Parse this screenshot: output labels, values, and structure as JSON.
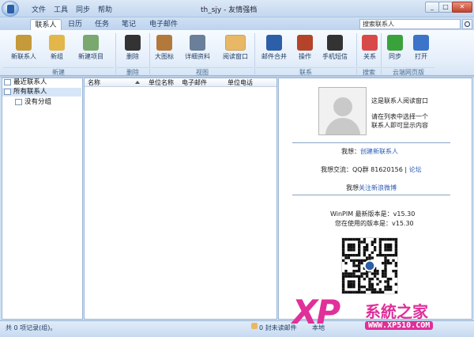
{
  "titlebar": {
    "menus": [
      "文件",
      "工具",
      "同步",
      "帮助"
    ],
    "window_title": "th_sjy - 友情强档"
  },
  "ribbon_tabs": [
    "联系人",
    "日历",
    "任务",
    "笔记",
    "电子邮件"
  ],
  "search": {
    "placeholder": "搜索联系人"
  },
  "ribbon": {
    "buttons": [
      {
        "label": "新联系人",
        "icon": "new-contact-icon",
        "color": "#c49a3a"
      },
      {
        "label": "新组",
        "icon": "new-group-icon",
        "color": "#e3b64a"
      },
      {
        "label": "新建项目",
        "icon": "new-item-icon",
        "color": "#7aa86f"
      },
      {
        "label": "删除",
        "icon": "delete-icon",
        "color": "#333333"
      },
      {
        "label": "大图标",
        "icon": "large-icons-icon",
        "color": "#b3793a"
      },
      {
        "label": "详细资料",
        "icon": "details-icon",
        "color": "#6a7f99"
      },
      {
        "label": "阅读窗口",
        "icon": "reading-pane-icon",
        "color": "#e8b867"
      },
      {
        "label": "邮件合并",
        "icon": "mail-merge-icon",
        "color": "#2d5ea8"
      },
      {
        "label": "操作",
        "icon": "action-icon",
        "color": "#b5432a"
      },
      {
        "label": "手机短信",
        "icon": "sms-phone-icon",
        "color": "#333333"
      },
      {
        "label": "关系",
        "icon": "relation-icon",
        "color": "#d84a4a"
      },
      {
        "label": "同步",
        "icon": "sync-icon",
        "color": "#3aa23a"
      },
      {
        "label": "打开",
        "icon": "open-icon",
        "color": "#3b74c9"
      }
    ],
    "groups": [
      "新建",
      "删除",
      "视图",
      "联系",
      "搜索",
      "云端网页版"
    ]
  },
  "nav": {
    "items": [
      "最近联系人",
      "所有联系人",
      "没有分组"
    ]
  },
  "list": {
    "columns": [
      "名称",
      "单位名称",
      "单位电话",
      "单位电话"
    ]
  },
  "reading": {
    "intro_line1": "这是联系人阅读窗口",
    "intro_line2": "请在列表中选择一个",
    "intro_line3": "联系人即可显示内容",
    "create_prefix": "我想：",
    "create_link": "创建新联系人",
    "qq_prefix": "我想交流：QQ群 81620156 | ",
    "qq_link": "论坛",
    "weibo_prefix": "我想",
    "weibo_link": "关注新浪微博",
    "latest_version": "WinPIM 最新版本是：v15.30",
    "current_version": "您在使用的版本是：v15.30"
  },
  "status": {
    "records": "共 0 项记录(组)。",
    "unread": "0 封未读邮件",
    "local": "本地"
  },
  "watermark": {
    "logo": "XP",
    "text": "系統之家",
    "url": "WWW.XP510.COM"
  }
}
